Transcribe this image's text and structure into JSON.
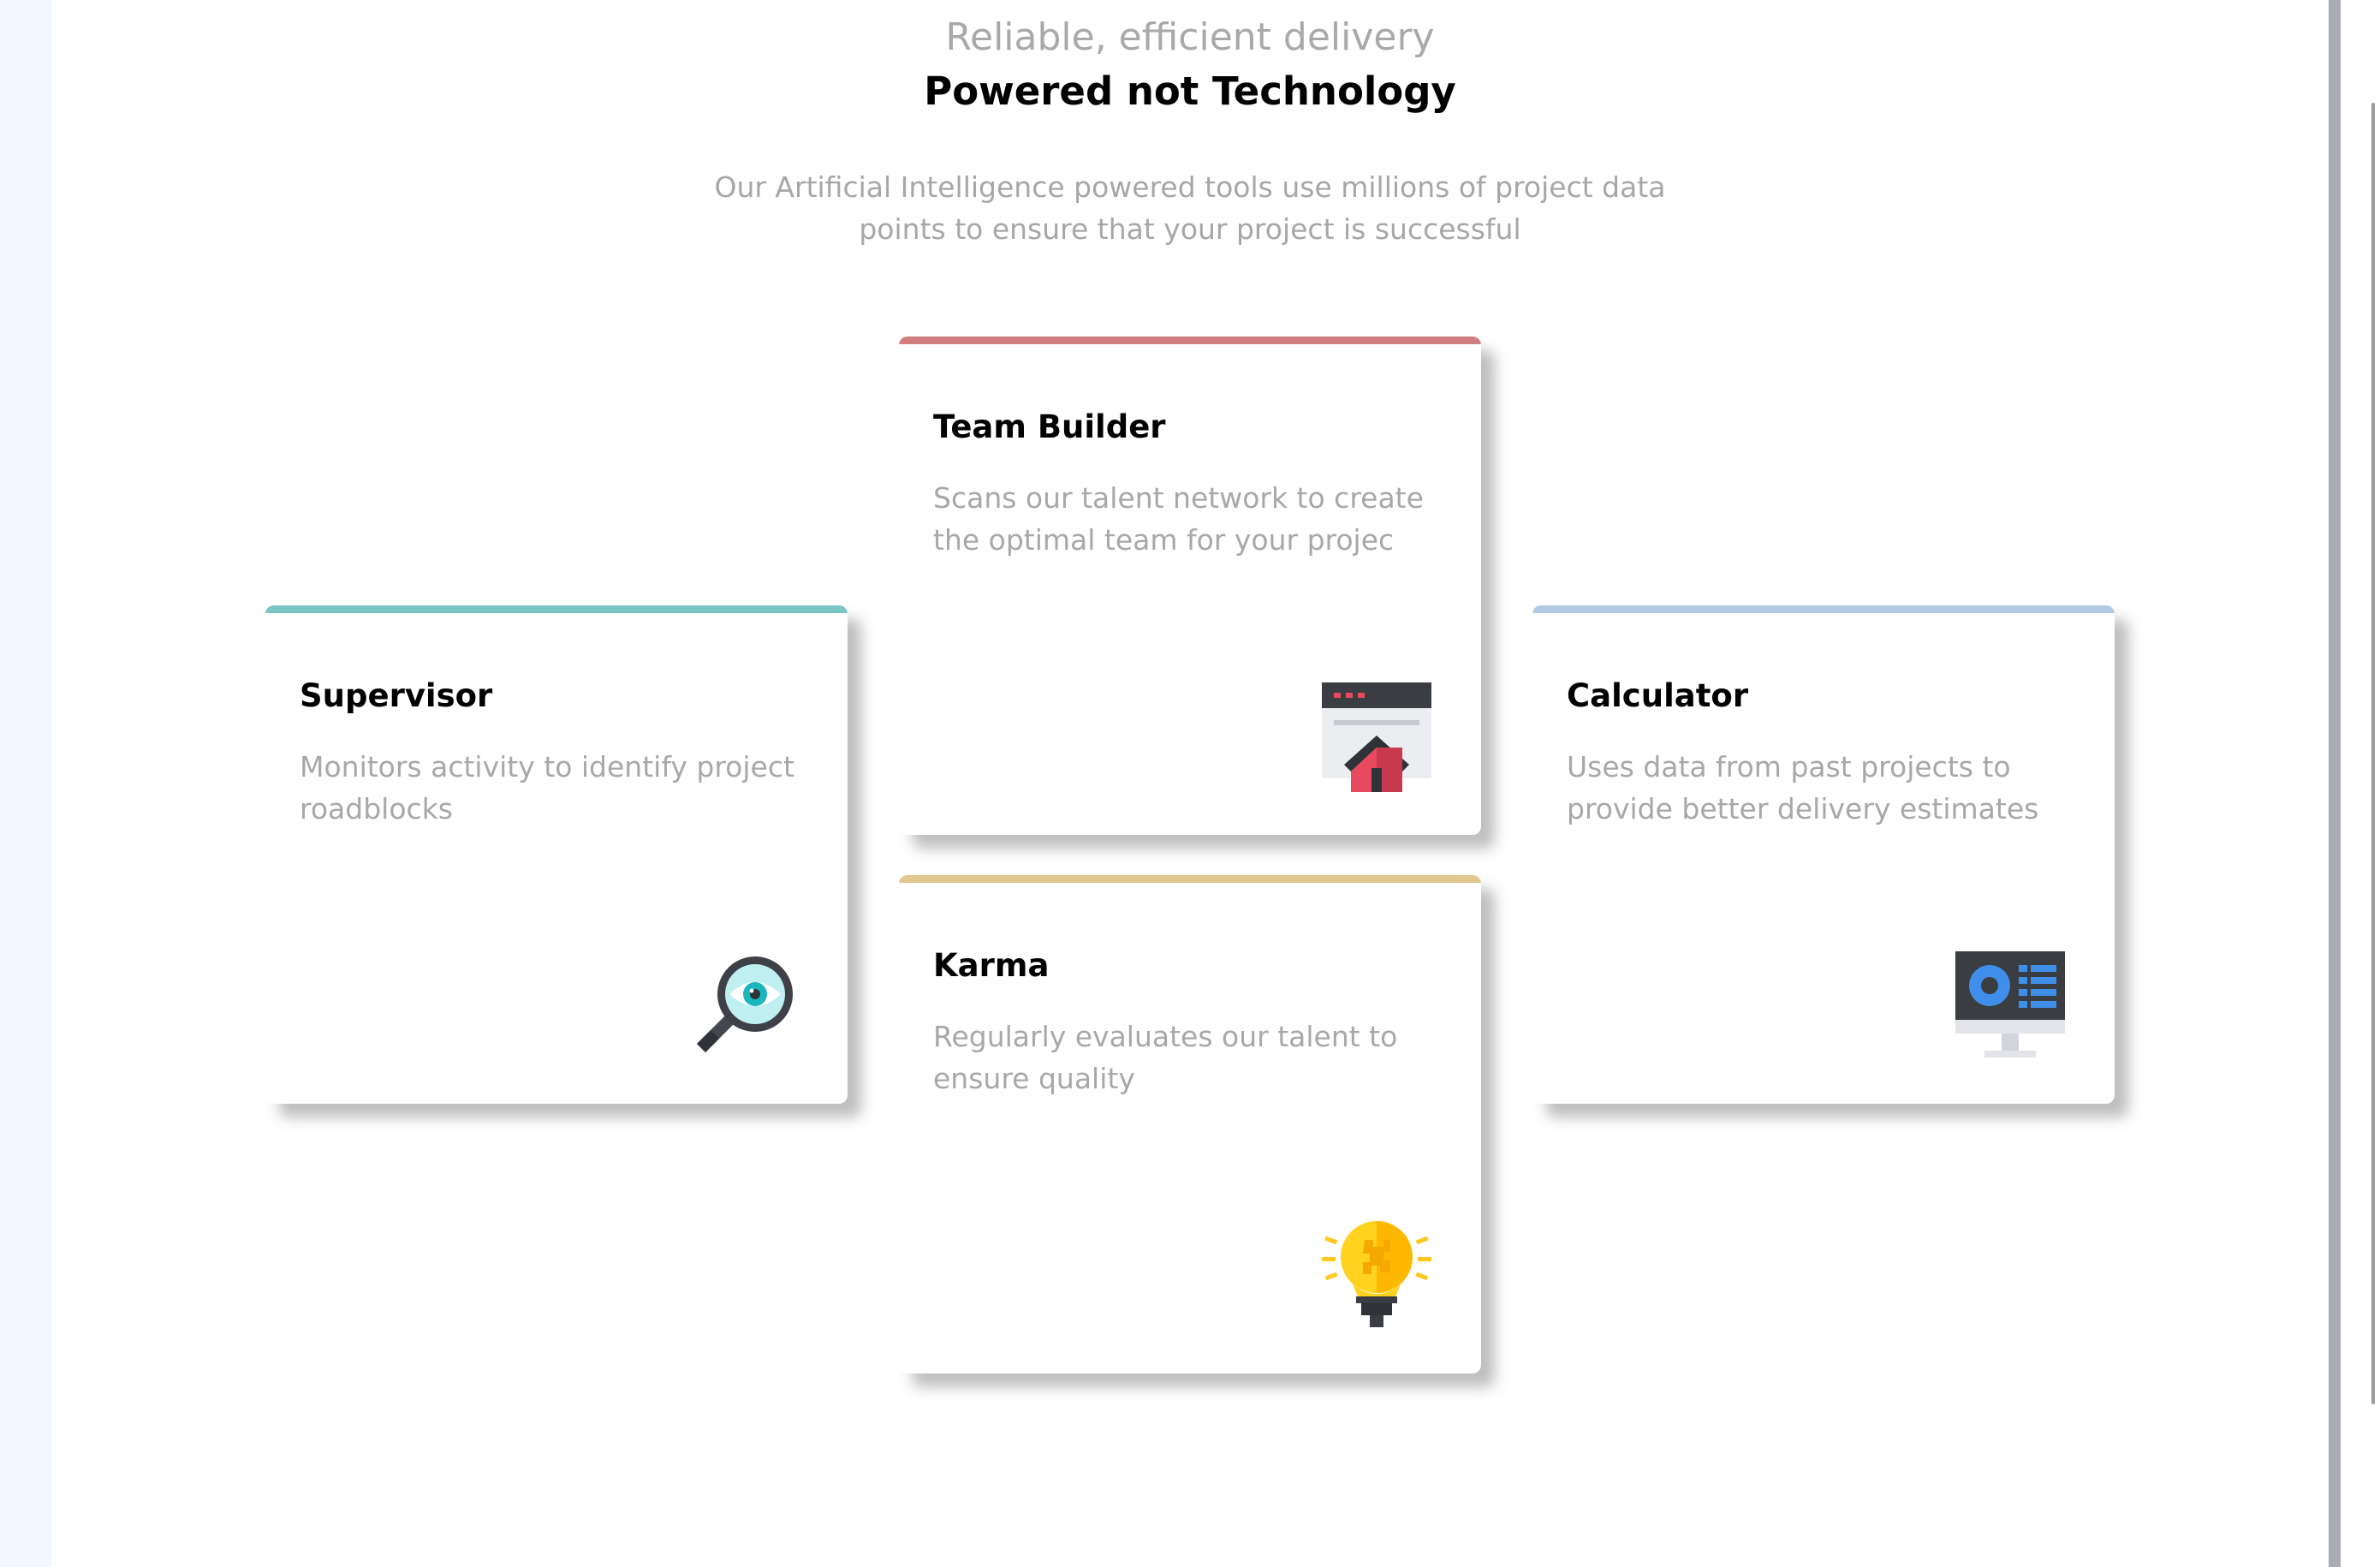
{
  "header": {
    "subtitle": "Reliable, efficient delivery",
    "title": "Powered not Technology",
    "description_line1": "Our Artificial Intelligence powered tools use millions of project data",
    "description_line2": "points to ensure that your project is successful"
  },
  "cards": {
    "supervisor": {
      "title": "Supervisor",
      "text": "Monitors activity to identify project roadblocks",
      "icon": "magnifier-eye-icon",
      "accent": "#79c6c4"
    },
    "team_builder": {
      "title": "Team Builder",
      "text": "Scans our talent network to create the optimal team for your projec",
      "icon": "team-window-icon",
      "accent": "#d27d7f"
    },
    "karma": {
      "title": "Karma",
      "text": "Regularly evaluates our talent to ensure quality",
      "icon": "lightbulb-icon",
      "accent": "#e2c88f"
    },
    "calculator": {
      "title": "Calculator",
      "text": "Uses data from past projects to provide better delivery estimates",
      "icon": "monitor-chart-icon",
      "accent": "#b2cbe2"
    }
  }
}
